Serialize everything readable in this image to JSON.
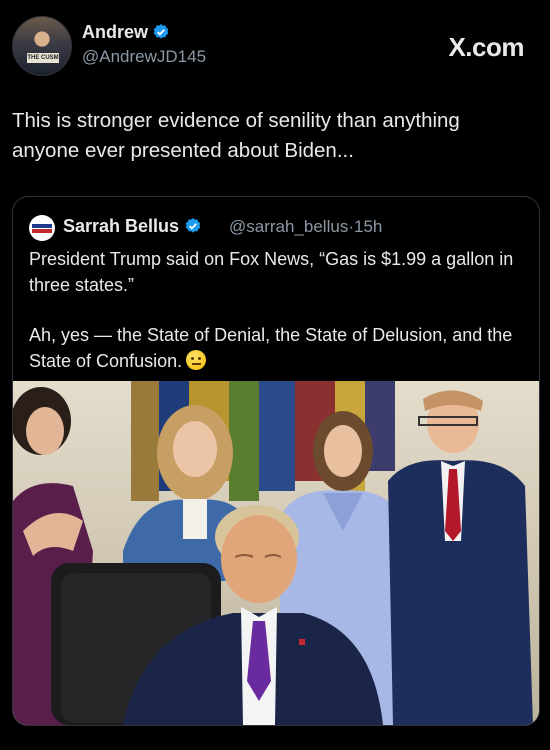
{
  "post": {
    "author": {
      "name": "Andrew",
      "handle": "@AndrewJD145",
      "verified": true,
      "avatar_sign_text": "THE CUSM"
    },
    "brand": "X.com",
    "text": "This is stronger evidence of senility than anything anyone ever presented about Biden..."
  },
  "quote": {
    "author": {
      "name": "Sarrah Bellus",
      "handle": "@sarrah_bellus",
      "verified": true
    },
    "time": "15h",
    "separator": "·",
    "paragraphs": [
      "President Trump said on Fox News, “Gas is $1.99 a gallon in three states.”",
      "Ah, yes — the State of Denial, the State of Delusion, and the State of Confusion."
    ],
    "emoji": "face-with-raised-eyebrow-icon",
    "image": "photo of a group in the Oval Office; a man in a dark suit with a purple tie sits with eyes closed in the foreground"
  },
  "colors": {
    "background": "#000000",
    "text": "#e7e9ea",
    "secondary_text": "#8b98a5",
    "border": "#2f3336",
    "verified_blue": "#1d9bf0"
  }
}
